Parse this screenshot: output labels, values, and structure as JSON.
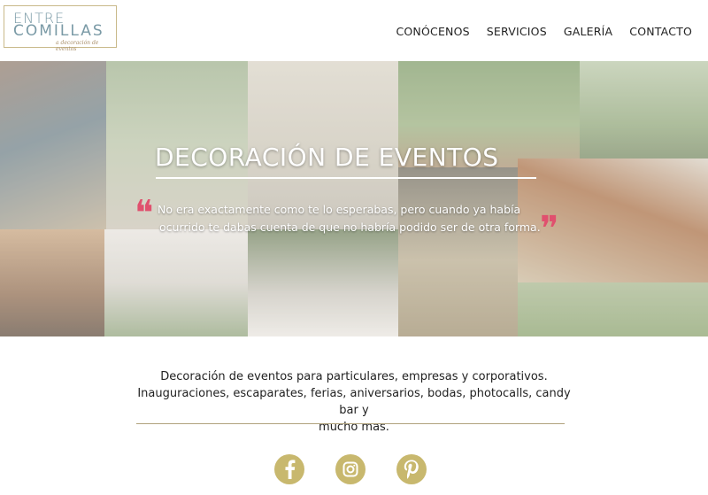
{
  "logo": {
    "line1": "ENTRE",
    "line2": "COMILLAS",
    "tagline": "a decoración de eventos"
  },
  "nav": {
    "items": [
      "CONÓCENOS",
      "SERVICIOS",
      "GALERÍA",
      "CONTACTO"
    ]
  },
  "hero": {
    "title": "DECORACIÓN DE EVENTOS",
    "quote_line1": "No era exactamente como te lo esperabas, pero cuando ya había",
    "quote_line2": "ocurrido te dabas cuenta de que no habría podido ser de otra forma.",
    "quote_open": "❝",
    "quote_close": "❞"
  },
  "intro": {
    "line1": "Decoración de eventos para particulares, empresas y corporativos.",
    "line2": "Inauguraciones, escaparates, ferias, aniversarios, bodas, photocalls, candy bar y",
    "line3": "mucho mas."
  },
  "social": {
    "icons": [
      "facebook-icon",
      "instagram-icon",
      "pinterest-icon"
    ],
    "color": "#c8b86e"
  },
  "colors": {
    "accent": "#c8b86e",
    "quote_marks": "#e0506e",
    "logo_text": "#7a9aa6"
  }
}
